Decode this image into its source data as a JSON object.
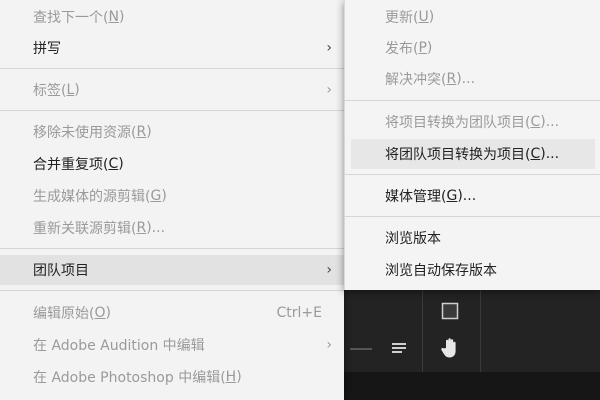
{
  "main_menu": {
    "items": [
      {
        "label": "查找下一个(",
        "mn": "N",
        "tail": ")",
        "disabled": true
      },
      {
        "label": "拼写",
        "mn": "",
        "tail": "",
        "disabled": false,
        "arrow": "›"
      },
      {
        "label": "标签(",
        "mn": "L",
        "tail": ")",
        "disabled": true,
        "arrow": "›"
      },
      {
        "label": "移除未使用资源(",
        "mn": "R",
        "tail": ")",
        "disabled": true
      },
      {
        "label": "合并重复项(",
        "mn": "C",
        "tail": ")",
        "disabled": false
      },
      {
        "label": "生成媒体的源剪辑(",
        "mn": "G",
        "tail": ")",
        "disabled": true
      },
      {
        "label": "重新关联源剪辑(",
        "mn": "R",
        "tail": ")...",
        "disabled": true
      },
      {
        "label": "团队项目",
        "mn": "",
        "tail": "",
        "disabled": false,
        "arrow": "›",
        "highlight": true
      },
      {
        "label": "编辑原始(",
        "mn": "O",
        "tail": ")",
        "disabled": true,
        "shortcut": "Ctrl+E"
      },
      {
        "label": "在 Adobe Audition 中编辑",
        "mn": "",
        "tail": "",
        "disabled": true,
        "arrow": "›"
      },
      {
        "label": "在 Adobe Photoshop 中编辑(",
        "mn": "H",
        "tail": ")",
        "disabled": true
      }
    ]
  },
  "sub_menu": {
    "items": [
      {
        "label": "更新(",
        "mn": "U",
        "tail": ")",
        "disabled": true
      },
      {
        "label": "发布(",
        "mn": "P",
        "tail": ")",
        "disabled": true
      },
      {
        "label": "解决冲突(",
        "mn": "R",
        "tail": ")...",
        "disabled": true
      },
      {
        "label": "将项目转换为团队项目(",
        "mn": "C",
        "tail": ")...",
        "disabled": true
      },
      {
        "label": "将团队项目转换为项目(",
        "mn": "C",
        "tail": ")...",
        "disabled": false,
        "highlight": true
      },
      {
        "label": "媒体管理(",
        "mn": "G",
        "tail": ")...",
        "disabled": false
      },
      {
        "label": "浏览版本",
        "mn": "",
        "tail": "",
        "disabled": false
      },
      {
        "label": "浏览自动保存版本",
        "mn": "",
        "tail": "",
        "disabled": false
      }
    ]
  },
  "icons": {
    "submenu_arrow": "chevron-right-icon",
    "stop_tool": "square-icon",
    "list_tool": "list-icon",
    "hand_tool": "hand-icon"
  },
  "colors": {
    "menu_bg": "#f3f3f3",
    "highlight": "#e2e2e2",
    "disabled_text": "#9a9a9a",
    "app_bg": "#1b1b1b"
  }
}
